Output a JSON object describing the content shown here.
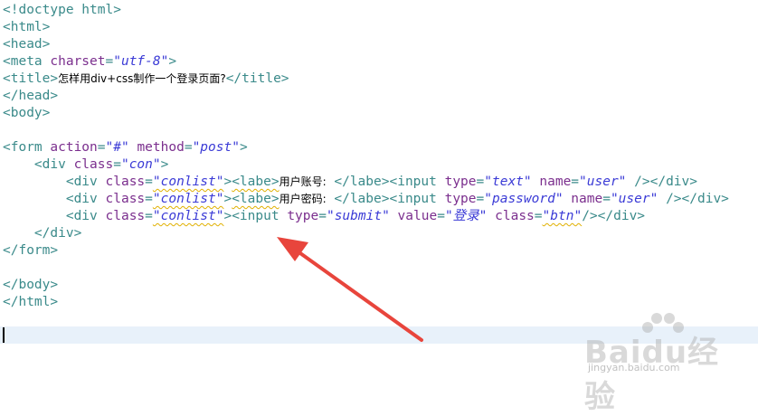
{
  "code_lines": [
    {
      "parts": [
        {
          "t": "<!doctype html>",
          "c": "tag"
        }
      ]
    },
    {
      "parts": [
        {
          "t": "<html>",
          "c": "tag"
        }
      ]
    },
    {
      "parts": [
        {
          "t": "<head>",
          "c": "tag"
        }
      ]
    },
    {
      "parts": [
        {
          "t": "<meta ",
          "c": "tag"
        },
        {
          "t": "charset",
          "c": "attr"
        },
        {
          "t": "=",
          "c": "tag"
        },
        {
          "t": "\"utf-8\"",
          "c": "str"
        },
        {
          "t": ">",
          "c": "tag"
        }
      ]
    },
    {
      "parts": [
        {
          "t": "<title>",
          "c": "tag"
        },
        {
          "t": "怎样用div+css制作一个登录页面?",
          "c": "txt"
        },
        {
          "t": "</title>",
          "c": "tag"
        }
      ]
    },
    {
      "parts": [
        {
          "t": "</head>",
          "c": "tag"
        }
      ]
    },
    {
      "parts": [
        {
          "t": "<body>",
          "c": "tag"
        }
      ]
    },
    {
      "parts": [
        {
          "t": "",
          "c": "tag"
        }
      ]
    },
    {
      "parts": [
        {
          "t": "<form ",
          "c": "tag"
        },
        {
          "t": "action",
          "c": "attr"
        },
        {
          "t": "=",
          "c": "tag"
        },
        {
          "t": "\"#\"",
          "c": "str"
        },
        {
          "t": " ",
          "c": "tag"
        },
        {
          "t": "method",
          "c": "attr"
        },
        {
          "t": "=",
          "c": "tag"
        },
        {
          "t": "\"post\"",
          "c": "str"
        },
        {
          "t": ">",
          "c": "tag"
        }
      ]
    },
    {
      "parts": [
        {
          "t": "    <div ",
          "c": "tag"
        },
        {
          "t": "class",
          "c": "attr"
        },
        {
          "t": "=",
          "c": "tag"
        },
        {
          "t": "\"con\"",
          "c": "str"
        },
        {
          "t": ">",
          "c": "tag"
        }
      ]
    },
    {
      "parts": [
        {
          "t": "        <div ",
          "c": "tag"
        },
        {
          "t": "class",
          "c": "attr"
        },
        {
          "t": "=",
          "c": "tag"
        },
        {
          "t": "\"conlist\"",
          "c": "str sq"
        },
        {
          "t": ">",
          "c": "tag"
        },
        {
          "t": "<labe>",
          "c": "tag sq"
        },
        {
          "t": "用户账号:",
          "c": "txt"
        },
        {
          "t": " </labe>",
          "c": "tag"
        },
        {
          "t": "<input ",
          "c": "tag"
        },
        {
          "t": "type",
          "c": "attr"
        },
        {
          "t": "=",
          "c": "tag"
        },
        {
          "t": "\"text\"",
          "c": "str"
        },
        {
          "t": " ",
          "c": "tag"
        },
        {
          "t": "name",
          "c": "attr"
        },
        {
          "t": "=",
          "c": "tag"
        },
        {
          "t": "\"user\"",
          "c": "str"
        },
        {
          "t": " /></div>",
          "c": "tag"
        }
      ]
    },
    {
      "parts": [
        {
          "t": "        <div ",
          "c": "tag"
        },
        {
          "t": "class",
          "c": "attr"
        },
        {
          "t": "=",
          "c": "tag"
        },
        {
          "t": "\"conlist\"",
          "c": "str sq"
        },
        {
          "t": ">",
          "c": "tag"
        },
        {
          "t": "<labe>",
          "c": "tag sq"
        },
        {
          "t": "用户密码:",
          "c": "txt"
        },
        {
          "t": " </labe>",
          "c": "tag"
        },
        {
          "t": "<input ",
          "c": "tag"
        },
        {
          "t": "type",
          "c": "attr"
        },
        {
          "t": "=",
          "c": "tag"
        },
        {
          "t": "\"password\"",
          "c": "str"
        },
        {
          "t": " ",
          "c": "tag"
        },
        {
          "t": "name",
          "c": "attr"
        },
        {
          "t": "=",
          "c": "tag"
        },
        {
          "t": "\"user\"",
          "c": "str"
        },
        {
          "t": " /></div>",
          "c": "tag"
        }
      ]
    },
    {
      "parts": [
        {
          "t": "        <div ",
          "c": "tag"
        },
        {
          "t": "class",
          "c": "attr"
        },
        {
          "t": "=",
          "c": "tag"
        },
        {
          "t": "\"conlist\"",
          "c": "str sq"
        },
        {
          "t": ">",
          "c": "tag"
        },
        {
          "t": "<input ",
          "c": "tag"
        },
        {
          "t": "type",
          "c": "attr"
        },
        {
          "t": "=",
          "c": "tag"
        },
        {
          "t": "\"submit\"",
          "c": "str"
        },
        {
          "t": " ",
          "c": "tag"
        },
        {
          "t": "value",
          "c": "attr"
        },
        {
          "t": "=",
          "c": "tag"
        },
        {
          "t": "\"登录\"",
          "c": "str"
        },
        {
          "t": " ",
          "c": "tag"
        },
        {
          "t": "class",
          "c": "attr"
        },
        {
          "t": "=",
          "c": "tag"
        },
        {
          "t": "\"btn\"",
          "c": "str sq"
        },
        {
          "t": "/></div>",
          "c": "tag"
        }
      ]
    },
    {
      "parts": [
        {
          "t": "    </div>",
          "c": "tag"
        }
      ]
    },
    {
      "parts": [
        {
          "t": "</form>",
          "c": "tag"
        }
      ]
    },
    {
      "parts": [
        {
          "t": "",
          "c": "tag"
        }
      ]
    },
    {
      "parts": [
        {
          "t": "</body>",
          "c": "tag"
        }
      ]
    },
    {
      "parts": [
        {
          "t": "</html>",
          "c": "tag"
        }
      ]
    }
  ],
  "watermark": {
    "brand": "Baidu经验",
    "url": "jingyan.baidu.com"
  },
  "colors": {
    "tag": "#3a8a8a",
    "attribute": "#7b2f8e",
    "string": "#3b3bd6",
    "arrow": "#e8453c",
    "current_line": "#e8f1fa"
  }
}
